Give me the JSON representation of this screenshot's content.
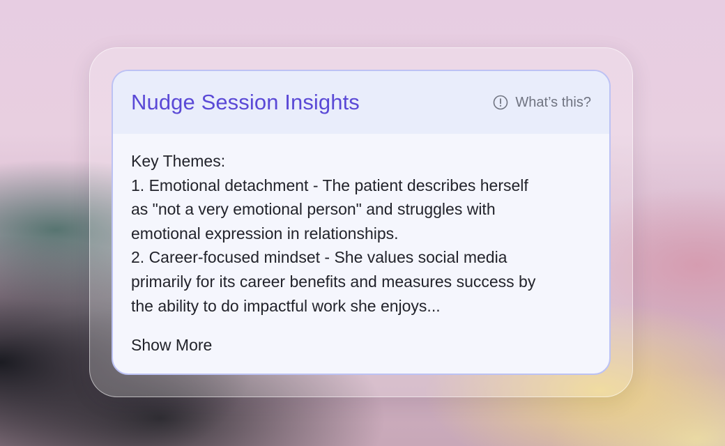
{
  "card": {
    "title": "Nudge Session Insights",
    "help_label": "What’s this?",
    "help_icon": "info-circle-icon",
    "body_lines": [
      "Key Themes:",
      "1. Emotional detachment - The patient describes herself",
      "as \"not a very emotional person\" and struggles with",
      "emotional expression in relationships.",
      "2. Career-focused mindset - She values social media",
      "primarily for its career benefits and measures success by",
      "the ability to do impactful work she enjoys..."
    ],
    "show_more_label": "Show More"
  },
  "colors": {
    "title": "#5a49d6",
    "card_border": "#bcc2f4",
    "header_bg": "#e9edfb",
    "card_bg": "#f5f6fd"
  }
}
